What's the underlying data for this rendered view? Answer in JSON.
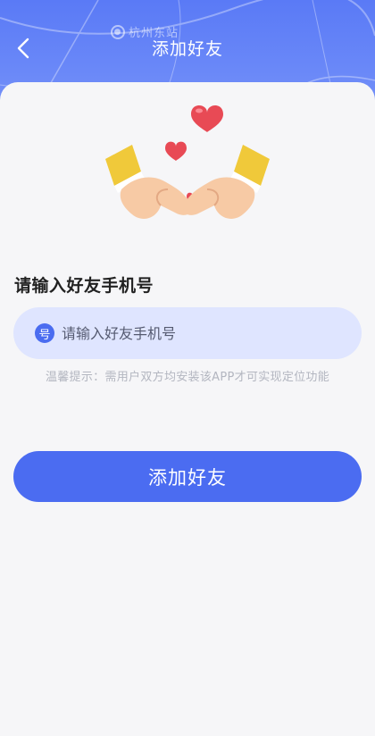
{
  "header": {
    "title": "添加好友",
    "back_icon": "chevron-left-icon",
    "map_label": "杭州东站",
    "map_pin_icon": "location-pin-icon"
  },
  "illustration": {
    "icon": "heart-hands-icon",
    "heart_color": "#e84a55",
    "sleeve_color": "#f0c93a"
  },
  "form": {
    "section_label": "请输入好友手机号",
    "phone_badge": "号",
    "phone_placeholder": "请输入好友手机号",
    "phone_value": "",
    "hint": "温馨提示：需用户双方均安装该APP才可实现定位功能"
  },
  "actions": {
    "add_label": "添加好友"
  },
  "colors": {
    "primary": "#4b6cf1",
    "input_bg": "#dfe5ff",
    "page_bg": "#f6f6f8"
  }
}
